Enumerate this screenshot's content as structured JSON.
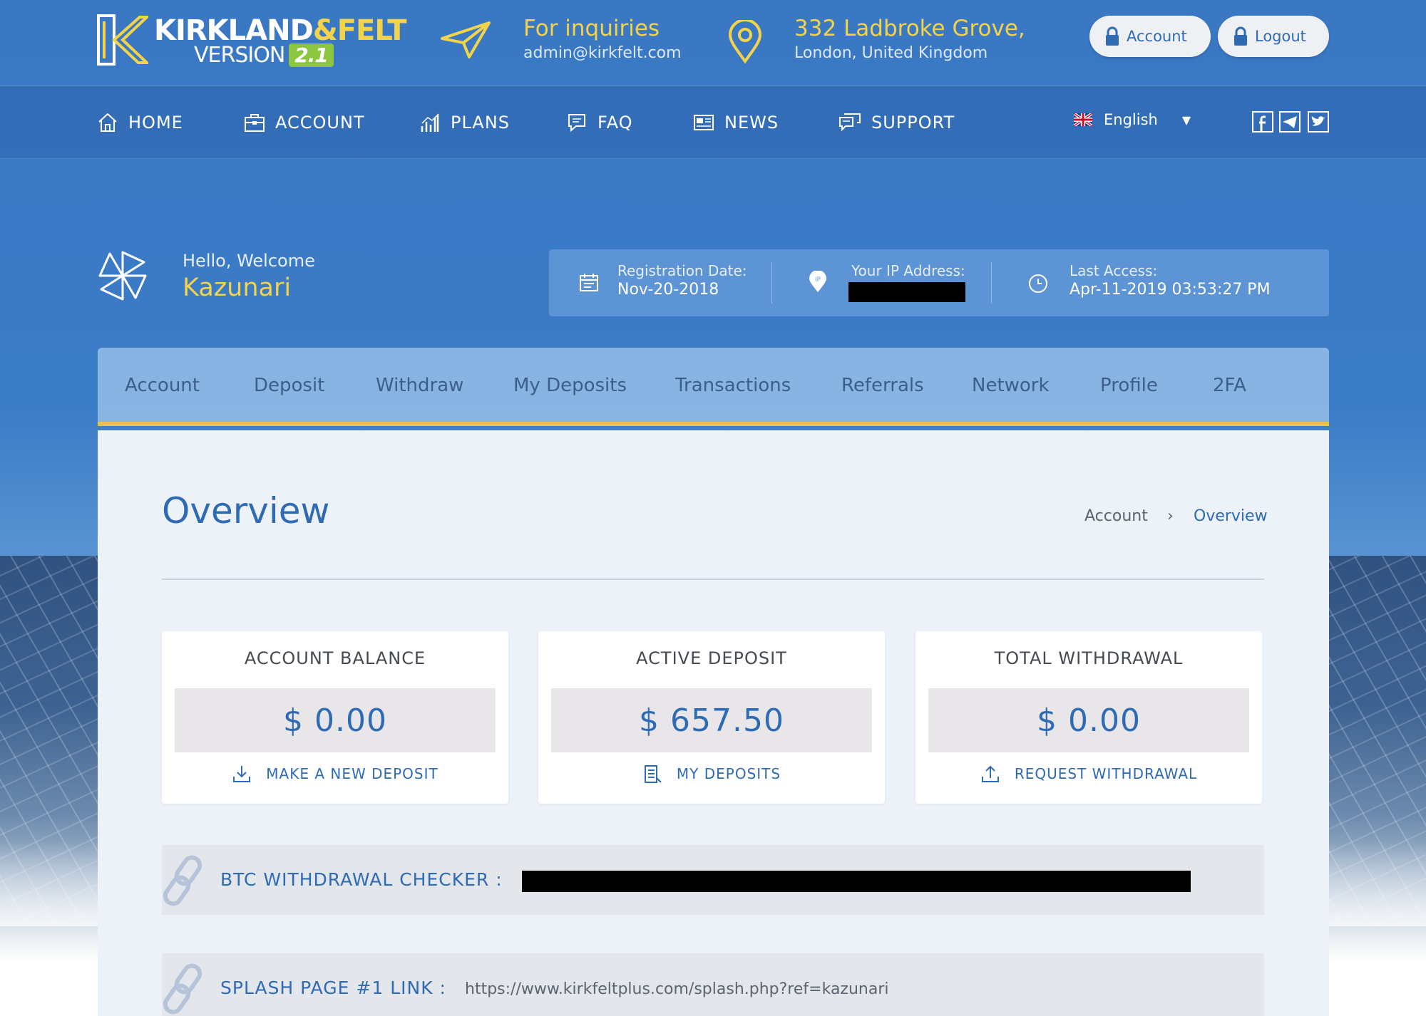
{
  "header": {
    "brand_name": "KIRKLAND",
    "brand_amp": "&FELT",
    "version_label": "VERSION",
    "version_number": "2.1",
    "inquiries_title": "For inquiries",
    "inquiries_email": "admin@kirkfelt.com",
    "address_line1": "332 Ladbroke Grove,",
    "address_line2": "London, United Kingdom",
    "account_button": "Account",
    "logout_button": "Logout"
  },
  "nav": {
    "items": [
      {
        "label": "HOME",
        "icon": "home-icon"
      },
      {
        "label": "ACCOUNT",
        "icon": "briefcase-icon"
      },
      {
        "label": "PLANS",
        "icon": "bar-chart-icon"
      },
      {
        "label": "FAQ",
        "icon": "chat-bubble-icon"
      },
      {
        "label": "NEWS",
        "icon": "newspaper-icon"
      },
      {
        "label": "SUPPORT",
        "icon": "support-chat-icon"
      }
    ],
    "language": "English",
    "social": [
      "facebook-icon",
      "telegram-icon",
      "twitter-icon"
    ]
  },
  "welcome": {
    "greeting": "Hello, Welcome",
    "username": "Kazunari",
    "registration_label": "Registration Date:",
    "registration_value": "Nov-20-2018",
    "ip_label": "Your IP Address:",
    "last_access_label": "Last Access:",
    "last_access_value": "Apr-11-2019 03:53:27 PM"
  },
  "tabs": [
    "Account",
    "Deposit",
    "Withdraw",
    "My Deposits",
    "Transactions",
    "Referrals",
    "Network",
    "Profile",
    "2FA"
  ],
  "overview": {
    "title": "Overview",
    "breadcrumb_root": "Account",
    "breadcrumb_sep": "›",
    "breadcrumb_current": "Overview",
    "cards": [
      {
        "title": "ACCOUNT BALANCE",
        "value": "$ 0.00",
        "link": "MAKE A NEW DEPOSIT",
        "icon": "download-icon"
      },
      {
        "title": "ACTIVE DEPOSIT",
        "value": "$ 657.50",
        "link": "MY DEPOSITS",
        "icon": "list-icon"
      },
      {
        "title": "TOTAL WITHDRAWAL",
        "value": "$ 0.00",
        "link": "REQUEST WITHDRAWAL",
        "icon": "upload-icon"
      }
    ],
    "btc_label": "BTC WITHDRAWAL CHECKER :",
    "splash_label": "SPLASH PAGE #1 LINK :",
    "splash_value": "https://www.kirkfeltplus.com/splash.php?ref=kazunari"
  },
  "colors": {
    "accent_yellow": "#f3d34a",
    "primary_blue": "#2f6bb5"
  }
}
